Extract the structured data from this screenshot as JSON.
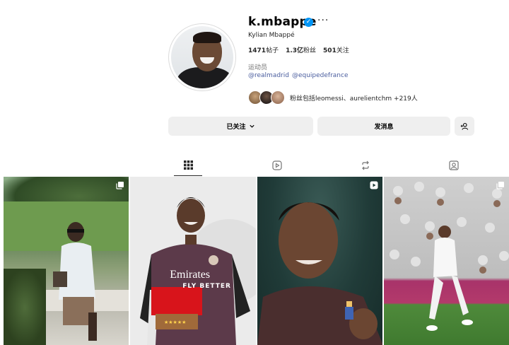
{
  "profile": {
    "username": "k.mbappe",
    "full_name": "Kylian Mbappé",
    "verified": true,
    "category": "运动员",
    "links": [
      "@realmadrid",
      "@equipedefrance"
    ],
    "followed_by": "粉丝包括leomessi、aurelientchm +219人"
  },
  "stats": {
    "posts_value": "1471",
    "posts_label": "帖子",
    "followers_value": "1.3亿",
    "followers_label": "粉丝",
    "following_value": "501",
    "following_label": "关注"
  },
  "actions": {
    "following_label": "已关注",
    "message_label": "发消息"
  },
  "tabs": [
    {
      "icon": "grid-icon",
      "active": true
    },
    {
      "icon": "reels-icon",
      "active": false
    },
    {
      "icon": "reposts-icon",
      "active": false
    },
    {
      "icon": "tagged-icon",
      "active": false
    }
  ],
  "posts": [
    {
      "type": "carousel",
      "icon": "carousel-icon"
    },
    {
      "type": "photo",
      "icon": ""
    },
    {
      "type": "reel",
      "icon": "reel-icon"
    },
    {
      "type": "carousel",
      "icon": "carousel-icon"
    }
  ],
  "post_texts": {
    "sponsor": "Emirates",
    "sponsor_line2": "FLY BETTER"
  },
  "colors": {
    "verified_badge": "#0095f6",
    "link": "#4a5d9e",
    "button_bg": "#efefef"
  }
}
